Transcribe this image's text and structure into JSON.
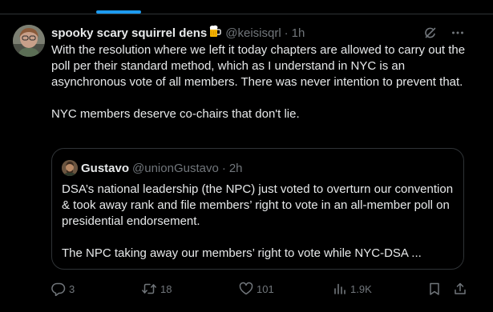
{
  "tweet": {
    "author": {
      "display_name": "spooky scary squirrel dens",
      "handle": "@keisisqrl",
      "time": "1h",
      "separator": "·",
      "avatar_icon": "user-avatar",
      "badge_icon": "beer-mug-emoji"
    },
    "text": [
      "With the resolution where we left it today chapters are allowed to carry out the poll per their standard method, which as I understand in NYC is an asynchronous vote of all members. There was never intention to prevent that.",
      "NYC members deserve co-chairs that don't lie."
    ],
    "header_icons": [
      "grok-icon",
      "more-icon"
    ],
    "quote": {
      "display_name": "Gustavo",
      "handle": "@unionGustavo",
      "time": "2h",
      "separator": "·",
      "text": [
        "DSA’s national leadership (the NPC) just voted to overturn our convention & took away rank and file members’ right to vote in an all-member poll on presidential endorsement.",
        "The NPC taking away our members’ right to vote while NYC-DSA ..."
      ]
    },
    "actions": {
      "replies": "3",
      "reposts": "18",
      "likes": "101",
      "views": "1.9K"
    }
  },
  "colors": {
    "background": "#000000",
    "text": "#e7e9ea",
    "muted": "#71767b",
    "border": "#2f3336",
    "accent": "#1d9bf0"
  }
}
